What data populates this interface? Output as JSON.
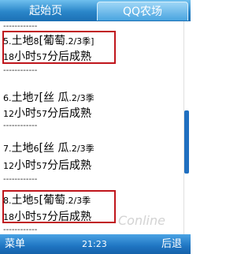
{
  "tabs": [
    {
      "label": "起始页"
    },
    {
      "label": "QQ农场"
    }
  ],
  "divider": "------------",
  "items": [
    {
      "num": "5.",
      "text1": "土地",
      "plot": "8",
      "crop": "[葡萄",
      "season": ".2/3季]",
      "hours": "18",
      "t1": "小时",
      "mins": "57",
      "t2": "分后成熟"
    },
    {
      "num": "6.",
      "text1": "土地",
      "plot": "7",
      "crop": "[丝 瓜",
      "season": ".2/3季",
      "hours": "12",
      "t1": "小时",
      "mins": "57",
      "t2": "分后成熟"
    },
    {
      "num": "7.",
      "text1": "土地",
      "plot": "6",
      "crop": "[丝 瓜",
      "season": ".2/3季",
      "hours": "12",
      "t1": "小时",
      "mins": "57",
      "t2": "分后成熟"
    },
    {
      "num": "8.",
      "text1": "土地",
      "plot": "5",
      "crop": "[葡萄",
      "season": ".2/3季",
      "hours": "18",
      "t1": "小时",
      "mins": "57",
      "t2": "分后成熟"
    }
  ],
  "bottom": {
    "menu": "菜单",
    "time": "21:23",
    "back": "后退"
  },
  "watermark": "Conline",
  "colors": {
    "highlight_border": "#c0161c",
    "bar_blue": "#1f75c2"
  }
}
